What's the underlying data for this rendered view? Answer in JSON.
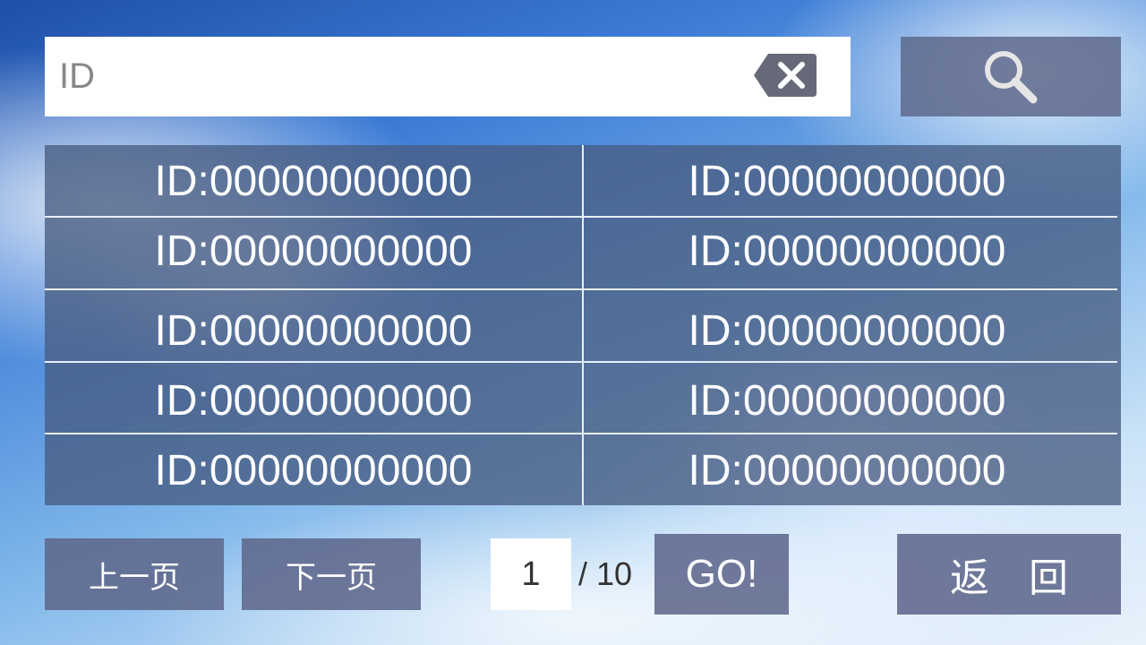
{
  "search": {
    "placeholder": "ID"
  },
  "results": [
    "ID:00000000000",
    "ID:00000000000",
    "ID:00000000000",
    "ID:00000000000",
    "ID:00000000000",
    "ID:00000000000",
    "ID:00000000000",
    "ID:00000000000",
    "ID:00000000000",
    "ID:00000000000"
  ],
  "pagination": {
    "prev_label": "上一页",
    "next_label": "下一页",
    "current_page": "1",
    "total_text": "/ 10",
    "go_label": "GO!"
  },
  "back_label": "返　回",
  "icons": {
    "clear": "backspace-clear-icon",
    "search": "magnifier-icon"
  },
  "colors": {
    "panel": "#5e688c",
    "text": "#ffffff",
    "field": "#ffffff"
  }
}
